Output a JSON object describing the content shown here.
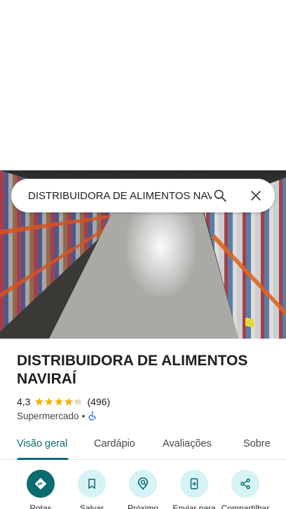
{
  "search": {
    "query": "DISTRIBUIDORA DE ALIMENTOS NAVIRAÍ",
    "search_icon": "search-icon",
    "close_icon": "close-icon"
  },
  "place": {
    "name": "DISTRIBUIDORA DE ALIMENTOS NAVIRAÍ",
    "rating": "4,3",
    "rating_value": 4.3,
    "reviews": "(496)",
    "category": "Supermercado",
    "separator": "•",
    "accessibility_icon": "wheelchair-icon"
  },
  "tabs": [
    {
      "label": "Visão geral",
      "active": true
    },
    {
      "label": "Cardápio",
      "active": false
    },
    {
      "label": "Avaliações",
      "active": false
    },
    {
      "label": "Sobre",
      "active": false
    }
  ],
  "actions": [
    {
      "label": "Rotas",
      "icon": "directions-icon"
    },
    {
      "label": "Salvar",
      "icon": "bookmark-icon"
    },
    {
      "label": "Próximo",
      "icon": "nearby-icon"
    },
    {
      "label": "Enviar para",
      "icon": "send-to-phone-icon"
    },
    {
      "label": "Compartilhar",
      "icon": "share-icon"
    }
  ],
  "colors": {
    "accent": "#0b6b6e",
    "action_bg": "#d6f3f5",
    "star": "#f5b400",
    "star_empty": "#dadce0",
    "accessibility": "#1a73e8"
  }
}
